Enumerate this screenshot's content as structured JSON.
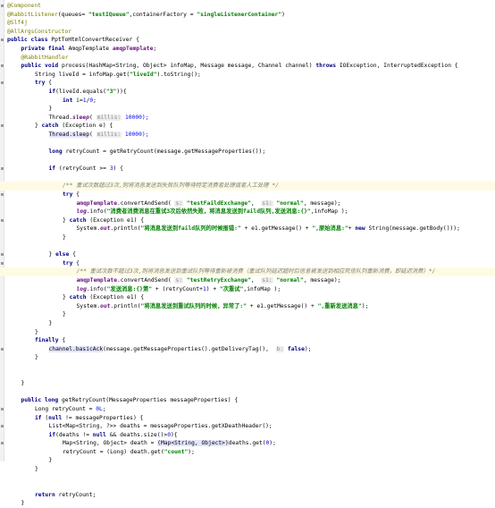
{
  "lines": [
    {
      "indent": 0,
      "tokens": [
        {
          "t": "@Component",
          "c": "an"
        }
      ]
    },
    {
      "indent": 0,
      "tokens": [
        {
          "t": "@RabbitListener",
          "c": "an"
        },
        {
          "t": "(queues= ",
          "c": "plain"
        },
        {
          "t": "\"testIQueue\"",
          "c": "str"
        },
        {
          "t": ",containerFactory = ",
          "c": "plain"
        },
        {
          "t": "\"singleListenerContainer\"",
          "c": "str"
        },
        {
          "t": ")",
          "c": "plain"
        }
      ]
    },
    {
      "indent": 0,
      "tokens": [
        {
          "t": "@Slf4j",
          "c": "an"
        }
      ]
    },
    {
      "indent": 0,
      "tokens": [
        {
          "t": "@AllArgsConstructor",
          "c": "an"
        }
      ]
    },
    {
      "indent": 0,
      "tokens": [
        {
          "t": "public class ",
          "c": "kw"
        },
        {
          "t": "PptToHtmlConvertReceiver {",
          "c": "plain"
        }
      ]
    },
    {
      "indent": 1,
      "tokens": [
        {
          "t": "private final ",
          "c": "kw"
        },
        {
          "t": "AmqpTemplate ",
          "c": "plain"
        },
        {
          "t": "amqpTemplate",
          "c": "fld"
        },
        {
          "t": ";",
          "c": "plain"
        }
      ]
    },
    {
      "indent": 1,
      "tokens": [
        {
          "t": "@RabbitHandler",
          "c": "an"
        }
      ]
    },
    {
      "indent": 1,
      "tokens": [
        {
          "t": "public void ",
          "c": "kw"
        },
        {
          "t": "process(HashMap<String, Object> infoMap, Message message, Channel channel) ",
          "c": "plain"
        },
        {
          "t": "throws ",
          "c": "kw"
        },
        {
          "t": "IOException, InterruptedException {",
          "c": "plain"
        }
      ]
    },
    {
      "indent": 2,
      "tokens": [
        {
          "t": "String liveId = infoMap.get(",
          "c": "plain"
        },
        {
          "t": "\"liveId\"",
          "c": "str"
        },
        {
          "t": ").toString();",
          "c": "plain"
        }
      ]
    },
    {
      "indent": 2,
      "tokens": [
        {
          "t": "try ",
          "c": "kw"
        },
        {
          "t": "{",
          "c": "plain"
        }
      ]
    },
    {
      "indent": 3,
      "tokens": [
        {
          "t": "if",
          "c": "kw"
        },
        {
          "t": "(liveId.equals(",
          "c": "plain"
        },
        {
          "t": "\"3\"",
          "c": "str"
        },
        {
          "t": ")){",
          "c": "plain"
        }
      ]
    },
    {
      "indent": 4,
      "tokens": [
        {
          "t": "int ",
          "c": "kw"
        },
        {
          "t": "i=",
          "c": "plain"
        },
        {
          "t": "1",
          "c": "num"
        },
        {
          "t": "/",
          "c": "plain"
        },
        {
          "t": "0",
          "c": "num"
        },
        {
          "t": ";",
          "c": "plain"
        }
      ]
    },
    {
      "indent": 3,
      "tokens": [
        {
          "t": "}",
          "c": "plain"
        }
      ]
    },
    {
      "indent": 3,
      "tokens": [
        {
          "t": "Thread.",
          "c": "plain"
        },
        {
          "t": "sleep",
          "c": "stc"
        },
        {
          "t": "( ",
          "c": "plain"
        },
        {
          "t": "millis:",
          "c": "hint"
        },
        {
          "t": " 10000);",
          "c": "num"
        }
      ]
    },
    {
      "indent": 2,
      "tokens": [
        {
          "t": "} ",
          "c": "plain"
        },
        {
          "t": "catch ",
          "c": "kw"
        },
        {
          "t": "(Exception e) {",
          "c": "plain"
        }
      ]
    },
    {
      "indent": 3,
      "tokens": [
        {
          "t": "Thread.sleep",
          "c": "sel"
        },
        {
          "t": "( ",
          "c": "plain"
        },
        {
          "t": "millis:",
          "c": "hint"
        },
        {
          "t": " 10000);",
          "c": "num"
        }
      ]
    },
    {
      "indent": 0,
      "tokens": []
    },
    {
      "indent": 3,
      "tokens": [
        {
          "t": "long ",
          "c": "kw"
        },
        {
          "t": "retryCount = getRetryCount(message.getMessageProperties());",
          "c": "plain"
        }
      ]
    },
    {
      "indent": 0,
      "tokens": []
    },
    {
      "indent": 3,
      "tokens": [
        {
          "t": "if ",
          "c": "kw"
        },
        {
          "t": "(retryCount >= ",
          "c": "plain"
        },
        {
          "t": "3",
          "c": "num"
        },
        {
          "t": ") {",
          "c": "plain"
        }
      ]
    },
    {
      "indent": 0,
      "tokens": []
    },
    {
      "indent": 4,
      "hl": true,
      "tokens": [
        {
          "t": "/** 重试次数超过3次,则将消息发送到失败队列等待特定消费者处理或者人工处理 */",
          "c": "cmt"
        }
      ]
    },
    {
      "indent": 4,
      "tokens": [
        {
          "t": "try ",
          "c": "kw"
        },
        {
          "t": "{",
          "c": "plain"
        }
      ]
    },
    {
      "indent": 5,
      "tokens": [
        {
          "t": "amqpTemplate",
          "c": "fld"
        },
        {
          "t": ".convertAndSend( ",
          "c": "plain"
        },
        {
          "t": "s:",
          "c": "hint"
        },
        {
          "t": " ",
          "c": "plain"
        },
        {
          "t": "\"testFaildExchange\"",
          "c": "str"
        },
        {
          "t": ",  ",
          "c": "plain"
        },
        {
          "t": "s1:",
          "c": "hint"
        },
        {
          "t": " ",
          "c": "plain"
        },
        {
          "t": "\"normal\"",
          "c": "str"
        },
        {
          "t": ", message);",
          "c": "plain"
        }
      ]
    },
    {
      "indent": 5,
      "tokens": [
        {
          "t": "log",
          "c": "stc"
        },
        {
          "t": ".info(",
          "c": "plain"
        },
        {
          "t": "\"消费者消费消息在重试3次后依然失败，将消息发送到faild队列,发送消息:{}\"",
          "c": "str"
        },
        {
          "t": ",infoMap );",
          "c": "plain"
        }
      ]
    },
    {
      "indent": 4,
      "tokens": [
        {
          "t": "} ",
          "c": "plain"
        },
        {
          "t": "catch ",
          "c": "kw"
        },
        {
          "t": "(Exception e1) {",
          "c": "plain"
        }
      ]
    },
    {
      "indent": 5,
      "tokens": [
        {
          "t": "System.",
          "c": "plain"
        },
        {
          "t": "out",
          "c": "stc"
        },
        {
          "t": ".println(",
          "c": "plain"
        },
        {
          "t": "\"将消息发送到faild队列的时候报错:\"",
          "c": "str"
        },
        {
          "t": " + e1.getMessage() + ",
          "c": "plain"
        },
        {
          "t": "\",原始消息:\"",
          "c": "str"
        },
        {
          "t": "+ ",
          "c": "plain"
        },
        {
          "t": "new ",
          "c": "kw"
        },
        {
          "t": "String(message.getBody()));",
          "c": "plain"
        }
      ]
    },
    {
      "indent": 4,
      "tokens": [
        {
          "t": "}",
          "c": "plain"
        }
      ]
    },
    {
      "indent": 0,
      "tokens": []
    },
    {
      "indent": 3,
      "tokens": [
        {
          "t": "} ",
          "c": "plain"
        },
        {
          "t": "else ",
          "c": "kw"
        },
        {
          "t": "{",
          "c": "plain"
        }
      ]
    },
    {
      "indent": 4,
      "tokens": [
        {
          "t": "try ",
          "c": "kw"
        },
        {
          "t": "{",
          "c": "plain"
        }
      ]
    },
    {
      "indent": 5,
      "hl": true,
      "tokens": [
        {
          "t": "/** 重试次数不超过3次,则将消息发送到重试队列等待重新被消费（重试队列延迟超时后信息被发送到相应死信队列重新消费，即延迟消费）*/",
          "c": "cmt"
        }
      ]
    },
    {
      "indent": 5,
      "tokens": [
        {
          "t": "amqpTemplate",
          "c": "fld"
        },
        {
          "t": ".convertAndSend( ",
          "c": "plain"
        },
        {
          "t": "s:",
          "c": "hint"
        },
        {
          "t": " ",
          "c": "plain"
        },
        {
          "t": "\"testRetryExchange\"",
          "c": "str"
        },
        {
          "t": ",  ",
          "c": "plain"
        },
        {
          "t": "s1:",
          "c": "hint"
        },
        {
          "t": " ",
          "c": "plain"
        },
        {
          "t": "\"normal\"",
          "c": "str"
        },
        {
          "t": ", message);",
          "c": "plain"
        }
      ]
    },
    {
      "indent": 5,
      "tokens": [
        {
          "t": "log",
          "c": "stc"
        },
        {
          "t": ".info(",
          "c": "plain"
        },
        {
          "t": "\"发送消息:{}第\"",
          "c": "str"
        },
        {
          "t": " + (retryCount+",
          "c": "plain"
        },
        {
          "t": "1",
          "c": "num"
        },
        {
          "t": ") + ",
          "c": "plain"
        },
        {
          "t": "\"次重试\"",
          "c": "str"
        },
        {
          "t": ",infoMap );",
          "c": "plain"
        }
      ]
    },
    {
      "indent": 4,
      "tokens": [
        {
          "t": "} ",
          "c": "plain"
        },
        {
          "t": "catch ",
          "c": "kw"
        },
        {
          "t": "(Exception e1) {",
          "c": "plain"
        }
      ]
    },
    {
      "indent": 5,
      "tokens": [
        {
          "t": "System.",
          "c": "plain"
        },
        {
          "t": "out",
          "c": "stc"
        },
        {
          "t": ".println(",
          "c": "plain"
        },
        {
          "t": "\"将消息发送到重试队列的时候，异常了:\"",
          "c": "str"
        },
        {
          "t": " + e1.getMessage() + ",
          "c": "plain"
        },
        {
          "t": "\",重新发送消息\"",
          "c": "str"
        },
        {
          "t": ");",
          "c": "plain"
        }
      ]
    },
    {
      "indent": 4,
      "tokens": [
        {
          "t": "}",
          "c": "plain"
        }
      ]
    },
    {
      "indent": 3,
      "tokens": [
        {
          "t": "}",
          "c": "plain"
        }
      ]
    },
    {
      "indent": 2,
      "tokens": [
        {
          "t": "}",
          "c": "plain"
        }
      ]
    },
    {
      "indent": 2,
      "tokens": [
        {
          "t": "finally ",
          "c": "kw"
        },
        {
          "t": "{",
          "c": "plain"
        }
      ]
    },
    {
      "indent": 3,
      "tokens": [
        {
          "t": "channel.basicAck",
          "c": "sel"
        },
        {
          "t": "(message.getMessageProperties().getDeliveryTag(),  ",
          "c": "plain"
        },
        {
          "t": "b:",
          "c": "hint"
        },
        {
          "t": " ",
          "c": "plain"
        },
        {
          "t": "false",
          "c": "kw"
        },
        {
          "t": ");",
          "c": "plain"
        }
      ]
    },
    {
      "indent": 2,
      "tokens": [
        {
          "t": "}",
          "c": "plain"
        }
      ]
    },
    {
      "indent": 0,
      "tokens": []
    },
    {
      "indent": 0,
      "tokens": []
    },
    {
      "indent": 1,
      "tokens": [
        {
          "t": "}",
          "c": "plain"
        }
      ]
    },
    {
      "indent": 0,
      "tokens": []
    },
    {
      "indent": 1,
      "tokens": [
        {
          "t": "public long ",
          "c": "kw"
        },
        {
          "t": "getRetryCount(MessageProperties messageProperties) {",
          "c": "plain"
        }
      ]
    },
    {
      "indent": 2,
      "tokens": [
        {
          "t": "Long retryCount = ",
          "c": "plain"
        },
        {
          "t": "0L",
          "c": "num"
        },
        {
          "t": ";",
          "c": "plain"
        }
      ]
    },
    {
      "indent": 2,
      "tokens": [
        {
          "t": "if ",
          "c": "kw"
        },
        {
          "t": "(",
          "c": "plain"
        },
        {
          "t": "null ",
          "c": "kw"
        },
        {
          "t": "!= messageProperties) {",
          "c": "plain"
        }
      ]
    },
    {
      "indent": 3,
      "tokens": [
        {
          "t": "List<Map<String, ?>> deaths = messageProperties.getXDeathHeader();",
          "c": "plain"
        }
      ]
    },
    {
      "indent": 3,
      "tokens": [
        {
          "t": "if",
          "c": "kw"
        },
        {
          "t": "(deaths != ",
          "c": "plain"
        },
        {
          "t": "null ",
          "c": "kw"
        },
        {
          "t": "&& deaths.size()>",
          "c": "plain"
        },
        {
          "t": "0",
          "c": "num"
        },
        {
          "t": "){",
          "c": "plain"
        }
      ]
    },
    {
      "indent": 4,
      "tokens": [
        {
          "t": "Map<String, Object> death = ",
          "c": "plain"
        },
        {
          "t": "(Map<String, Object>)",
          "c": "sel"
        },
        {
          "t": "deaths.get(",
          "c": "plain"
        },
        {
          "t": "0",
          "c": "num"
        },
        {
          "t": ");",
          "c": "plain"
        }
      ]
    },
    {
      "indent": 4,
      "tokens": [
        {
          "t": "retryCount = (Long) death.get(",
          "c": "plain"
        },
        {
          "t": "\"count\"",
          "c": "str"
        },
        {
          "t": ");",
          "c": "plain"
        }
      ]
    },
    {
      "indent": 3,
      "tokens": [
        {
          "t": "}",
          "c": "plain"
        }
      ]
    },
    {
      "indent": 2,
      "tokens": [
        {
          "t": "}",
          "c": "plain"
        }
      ]
    },
    {
      "indent": 0,
      "tokens": []
    },
    {
      "indent": 0,
      "tokens": []
    },
    {
      "indent": 2,
      "tokens": [
        {
          "t": "return ",
          "c": "kw"
        },
        {
          "t": "retryCount;",
          "c": "plain"
        }
      ]
    },
    {
      "indent": 1,
      "tokens": [
        {
          "t": "}",
          "c": "plain"
        }
      ]
    }
  ]
}
